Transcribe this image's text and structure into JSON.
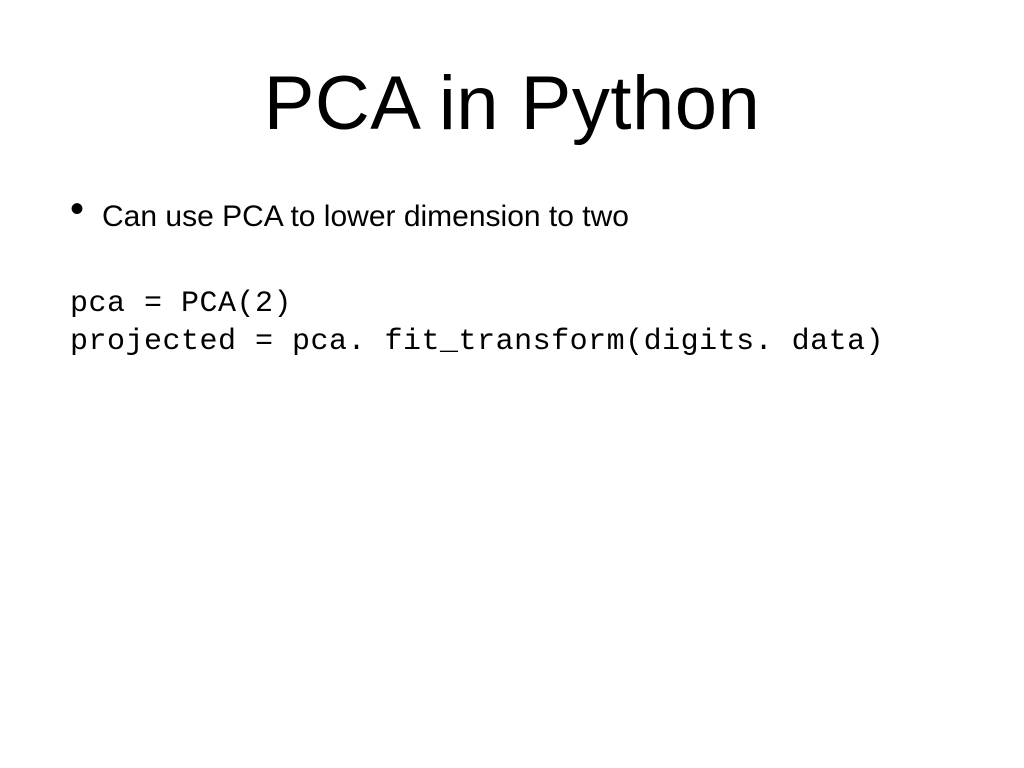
{
  "slide": {
    "title": "PCA in Python",
    "bullet": {
      "text": "Can use PCA to lower dimension to two"
    },
    "code": {
      "line1": "pca = PCA(2)",
      "line2": "projected = pca. fit_transform(digits. data)"
    }
  }
}
